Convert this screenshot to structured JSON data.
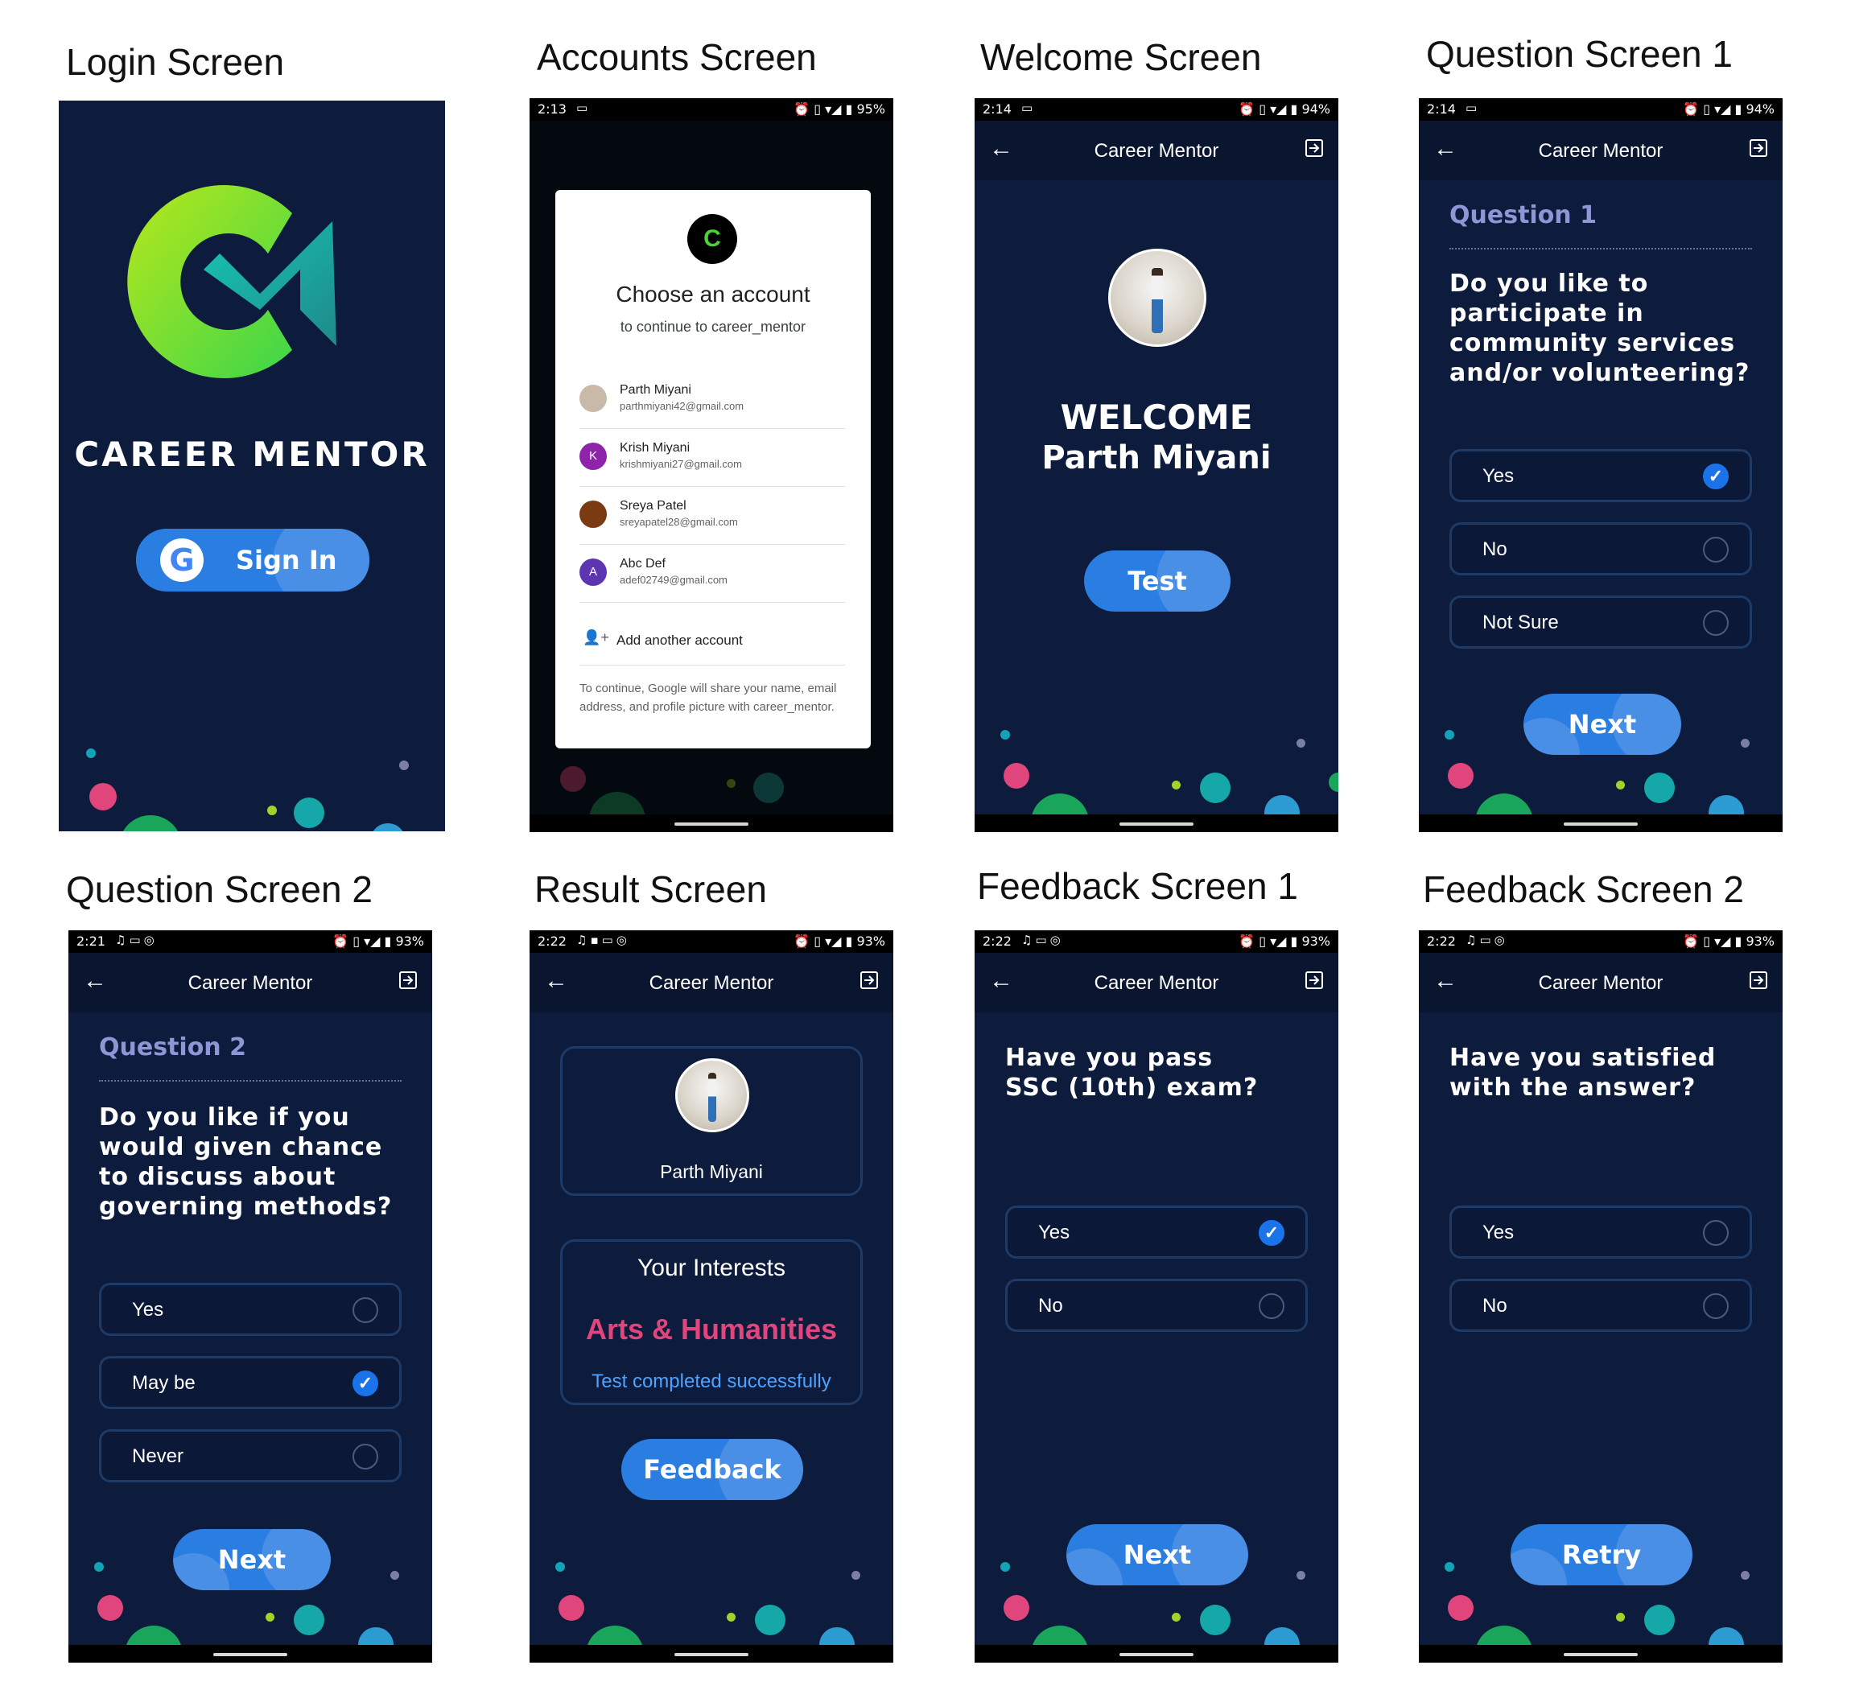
{
  "titles": {
    "login": "Login Screen",
    "accounts": "Accounts Screen",
    "welcome": "Welcome Screen",
    "q1": "Question Screen 1",
    "q2": "Question Screen 2",
    "result": "Result Screen",
    "fb1": "Feedback Screen 1",
    "fb2": "Feedback Screen 2"
  },
  "app_title": "Career Mentor",
  "colors": {
    "background": "#0d1b3c",
    "button": "#2a7de1",
    "accent_pink": "#e0457b",
    "question_label": "#8f96d6",
    "success_text": "#4da3ff"
  },
  "status": {
    "accounts": {
      "time": "2:13",
      "battery": "95%"
    },
    "welcome": {
      "time": "2:14",
      "battery": "94%"
    },
    "q1": {
      "time": "2:14",
      "battery": "94%"
    },
    "q2": {
      "time": "2:21",
      "battery": "93%"
    },
    "result": {
      "time": "2:22",
      "battery": "93%"
    },
    "fb1": {
      "time": "2:22",
      "battery": "93%"
    },
    "fb2": {
      "time": "2:22",
      "battery": "93%"
    }
  },
  "login": {
    "brand": "CAREER MENTOR",
    "signin": "Sign In"
  },
  "accounts": {
    "heading": "Choose an account",
    "sub": "to continue to career_mentor",
    "list": [
      {
        "name": "Parth Miyani",
        "email": "parthmiyani42@gmail.com",
        "initial": "",
        "color": "#c9b9a8"
      },
      {
        "name": "Krish Miyani",
        "email": "krishmiyani27@gmail.com",
        "initial": "K",
        "color": "#8e24aa"
      },
      {
        "name": "Sreya Patel",
        "email": "sreyapatel28@gmail.com",
        "initial": "",
        "color": "#7a3b12"
      },
      {
        "name": "Abc Def",
        "email": "adef02749@gmail.com",
        "initial": "A",
        "color": "#5e35b1"
      }
    ],
    "add": "Add another account",
    "note": "To continue, Google will share your name, email address, and profile picture with career_mentor."
  },
  "welcome": {
    "line1": "WELCOME",
    "line2": "Parth Miyani",
    "button": "Test"
  },
  "q1": {
    "label": "Question 1",
    "text": "Do you like to participate in community services and/or volunteering?",
    "options": [
      {
        "label": "Yes",
        "checked": true
      },
      {
        "label": "No",
        "checked": false
      },
      {
        "label": "Not Sure",
        "checked": false
      }
    ],
    "button": "Next"
  },
  "q2": {
    "label": "Question 2",
    "text": "Do you like if you would given chance to discuss about governing methods?",
    "options": [
      {
        "label": "Yes",
        "checked": false
      },
      {
        "label": "May be",
        "checked": true
      },
      {
        "label": "Never",
        "checked": false
      }
    ],
    "button": "Next"
  },
  "result": {
    "name": "Parth Miyani",
    "heading": "Your Interests",
    "interest": "Arts & Humanities",
    "status": "Test completed successfully",
    "button": "Feedback"
  },
  "fb1": {
    "text": "Have you pass SSC (10th) exam?",
    "options": [
      {
        "label": "Yes",
        "checked": true
      },
      {
        "label": "No",
        "checked": false
      }
    ],
    "button": "Next"
  },
  "fb2": {
    "text": "Have you satisfied with the answer?",
    "options": [
      {
        "label": "Yes",
        "checked": false
      },
      {
        "label": "No",
        "checked": false
      }
    ],
    "button": "Retry"
  }
}
